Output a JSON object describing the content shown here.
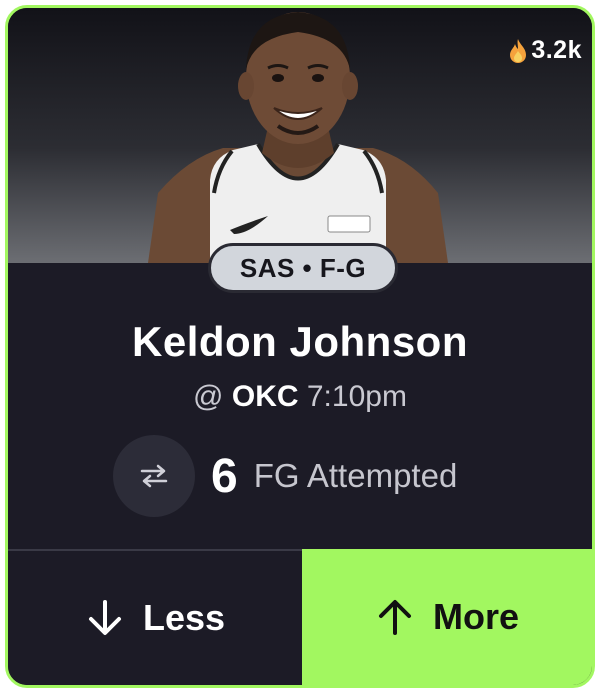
{
  "colors": {
    "accent": "#a2f760",
    "card_bg": "#1c1b26",
    "pill_bg": "#d2d6dc"
  },
  "card": {
    "popularity": {
      "icon": "flame-icon",
      "count": "3.2k"
    },
    "team_position": "SAS • F-G",
    "player_name": "Keldon Johnson",
    "matchup": {
      "prefix": "@",
      "opponent": "OKC",
      "time": "7:10pm"
    },
    "stat": {
      "icon": "swap-arrows-icon",
      "value": "6",
      "label": "FG Attempted"
    },
    "buttons": {
      "less": {
        "icon": "arrow-down-icon",
        "label": "Less"
      },
      "more": {
        "icon": "arrow-up-icon",
        "label": "More"
      }
    }
  }
}
